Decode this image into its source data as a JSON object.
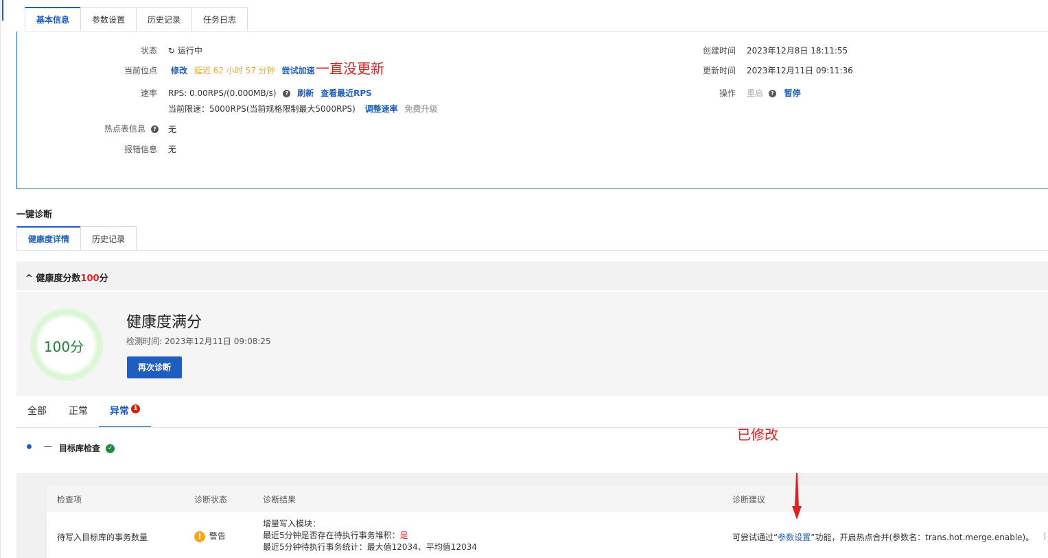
{
  "top_tabs": [
    "基本信息",
    "参数设置",
    "历史记录",
    "任务日志"
  ],
  "basic": {
    "status_label": "状态",
    "status_value": "运行中",
    "position_label": "当前位点",
    "position_modify": "修改",
    "position_delay": "延迟 62 小时 57 分钟",
    "position_accelerate": "尝试加速",
    "position_annotation": "一直没更新",
    "rate_label": "速率",
    "rate_rps": "RPS: 0.00RPS/(0.000MB/s)",
    "rate_refresh": "刷新",
    "rate_view_recent": "查看最近RPS",
    "rate_limit": "当前限速：5000RPS(当前规格限制最大5000RPS)",
    "rate_adjust": "调整速率",
    "rate_upgrade": "免费升级",
    "hot_table_label": "热点表信息",
    "hot_table_value": "无",
    "error_label": "报错信息",
    "error_value": "无",
    "created_label": "创建时间",
    "created_value": "2023年12月8日 18:11:55",
    "updated_label": "更新时间",
    "updated_value": "2023年12月11日 09:11:36",
    "ops_label": "操作",
    "ops_restart": "重启",
    "ops_pause": "暂停"
  },
  "diagnosis": {
    "section_title": "一键诊断",
    "tabs": [
      "健康度详情",
      "历史记录"
    ],
    "score_bar_prefix": "健康度分数",
    "score_bar_score": "100",
    "score_bar_suffix": "分",
    "ring_text": "100分",
    "health_title": "健康度满分",
    "detect_time": "检测时间: 2023年12月11日 09:08:25",
    "rediagnose_button": "再次诊断",
    "filter_tabs": [
      "全部",
      "正常",
      "异常"
    ],
    "abnormal_count": "1",
    "modified_annotation": "已修改",
    "group_title": "目标库检查",
    "table": {
      "headers": [
        "检查项",
        "诊断状态",
        "诊断结果",
        "诊断建议"
      ],
      "row": {
        "item": "待写入目标库的事务数量",
        "status": "警告",
        "result_line1": "增量写入模块：",
        "result_line2_prefix": "最近5分钟是否存在待执行事务堆积：",
        "result_line2_value": "是",
        "result_line3": "最近5分钟待执行事务统计：最大值12034、平均值12034",
        "advice_prefix": "可尝试通过“",
        "advice_link": "参数设置",
        "advice_suffix": "”功能，开启热点合并(参数名：trans.hot.merge.enable)。"
      }
    }
  },
  "colors": {
    "primary": "#1f5dbf",
    "success": "#52c41a",
    "warning": "#f5a623",
    "danger": "#e02020"
  }
}
